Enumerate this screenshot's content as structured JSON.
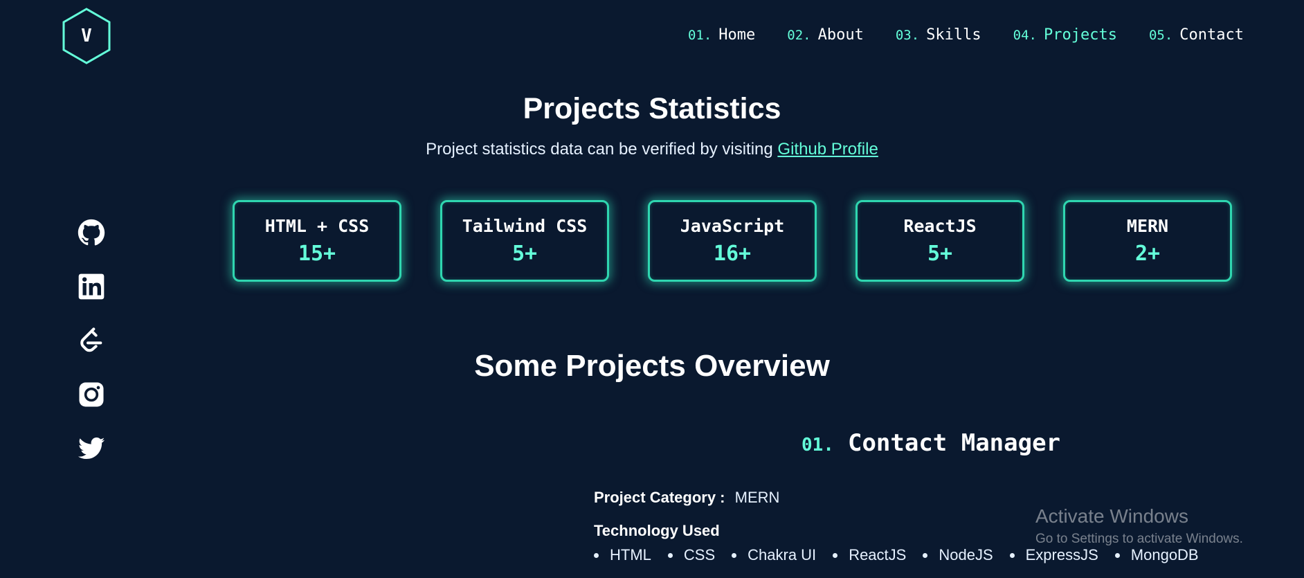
{
  "logo": {
    "letter": "V",
    "icon": "hexagon-logo-icon"
  },
  "nav": {
    "items": [
      {
        "num": "01.",
        "label": "Home"
      },
      {
        "num": "02.",
        "label": "About"
      },
      {
        "num": "03.",
        "label": "Skills"
      },
      {
        "num": "04.",
        "label": "Projects",
        "active": true
      },
      {
        "num": "05.",
        "label": "Contact"
      }
    ]
  },
  "social": [
    "github-icon",
    "linkedin-icon",
    "leetcode-icon",
    "instagram-icon",
    "twitter-icon"
  ],
  "stats": {
    "title": "Projects Statistics",
    "subtitle": "Project statistics data can be verified by visiting",
    "link": "Github Profile",
    "cards": [
      {
        "label": "HTML + CSS",
        "value": "15+"
      },
      {
        "label": "Tailwind CSS",
        "value": "5+"
      },
      {
        "label": "JavaScript",
        "value": "16+"
      },
      {
        "label": "ReactJS",
        "value": "5+"
      },
      {
        "label": "MERN",
        "value": "2+"
      }
    ]
  },
  "overview": {
    "title": "Some Projects Overview",
    "project": {
      "num": "01.",
      "name": "Contact Manager",
      "category_label": "Project Category :",
      "category": "MERN",
      "tech_label": "Technology Used",
      "tech": [
        "HTML",
        "CSS",
        "Chakra UI",
        "ReactJS",
        "NodeJS",
        "ExpressJS",
        "MongoDB"
      ]
    }
  },
  "watermark": {
    "title": "Activate Windows",
    "subtitle": "Go to Settings to activate Windows."
  },
  "colors": {
    "background": "#0a192f",
    "accent": "#64ffda",
    "text": "#ffffff"
  }
}
